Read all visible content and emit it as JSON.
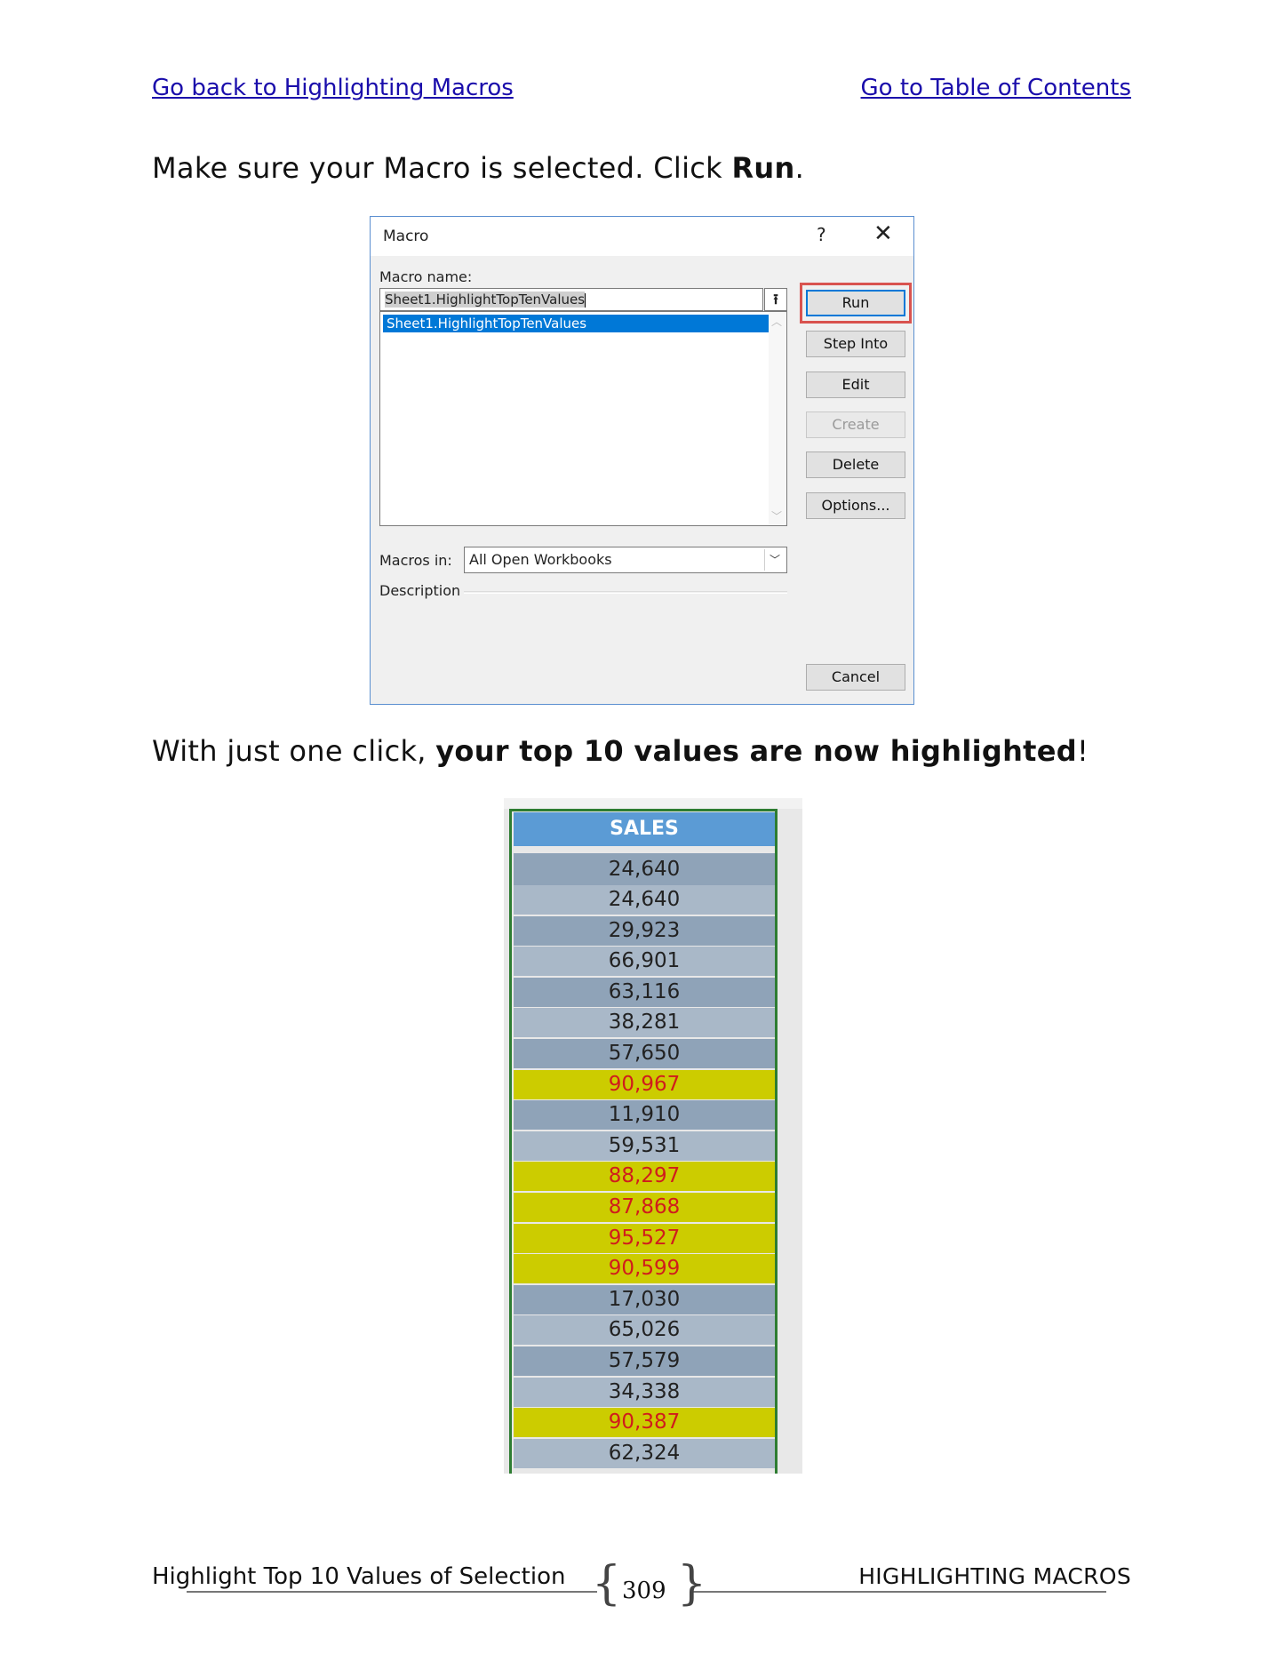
{
  "nav": {
    "back_link": "Go back to Highlighting Macros",
    "toc_link": "Go to Table of Contents"
  },
  "content": {
    "para1_prefix": "Make sure your Macro is selected. Click ",
    "para1_bold": "Run",
    "para1_suffix": ".",
    "para2_prefix": "With just one click, ",
    "para2_bold": "your top 10 values are now highlighted",
    "para2_suffix": "!"
  },
  "dialog": {
    "title": "Macro",
    "help_icon": "?",
    "close_icon": "✕",
    "macro_name_label": "Macro name:",
    "macro_name_value": "Sheet1.HighlightTopTenValues",
    "list_items": [
      "Sheet1.HighlightTopTenValues"
    ],
    "buttons": {
      "run": "Run",
      "step_into": "Step Into",
      "edit": "Edit",
      "create": "Create",
      "delete": "Delete",
      "options": "Options...",
      "cancel": "Cancel"
    },
    "macros_in_label": "Macros in:",
    "macros_in_value": "All Open Workbooks",
    "description_label": "Description"
  },
  "sheet": {
    "header": "SALES",
    "highlight_fill": "#cccc00",
    "highlight_text": "#d01c1c",
    "rows": [
      {
        "value": "24,640",
        "highlighted": false
      },
      {
        "value": "24,640",
        "highlighted": false
      },
      {
        "value": "29,923",
        "highlighted": false
      },
      {
        "value": "66,901",
        "highlighted": false
      },
      {
        "value": "63,116",
        "highlighted": false
      },
      {
        "value": "38,281",
        "highlighted": false
      },
      {
        "value": "57,650",
        "highlighted": false
      },
      {
        "value": "90,967",
        "highlighted": true
      },
      {
        "value": "11,910",
        "highlighted": false
      },
      {
        "value": "59,531",
        "highlighted": false
      },
      {
        "value": "88,297",
        "highlighted": true
      },
      {
        "value": "87,868",
        "highlighted": true
      },
      {
        "value": "95,527",
        "highlighted": true
      },
      {
        "value": "90,599",
        "highlighted": true
      },
      {
        "value": "17,030",
        "highlighted": false
      },
      {
        "value": "65,026",
        "highlighted": false
      },
      {
        "value": "57,579",
        "highlighted": false
      },
      {
        "value": "34,338",
        "highlighted": false
      },
      {
        "value": "90,387",
        "highlighted": true
      },
      {
        "value": "62,324",
        "highlighted": false
      }
    ]
  },
  "footer": {
    "left": "Highlight Top 10 Values of Selection",
    "page_number": "309",
    "right": "HIGHLIGHTING MACROS"
  }
}
